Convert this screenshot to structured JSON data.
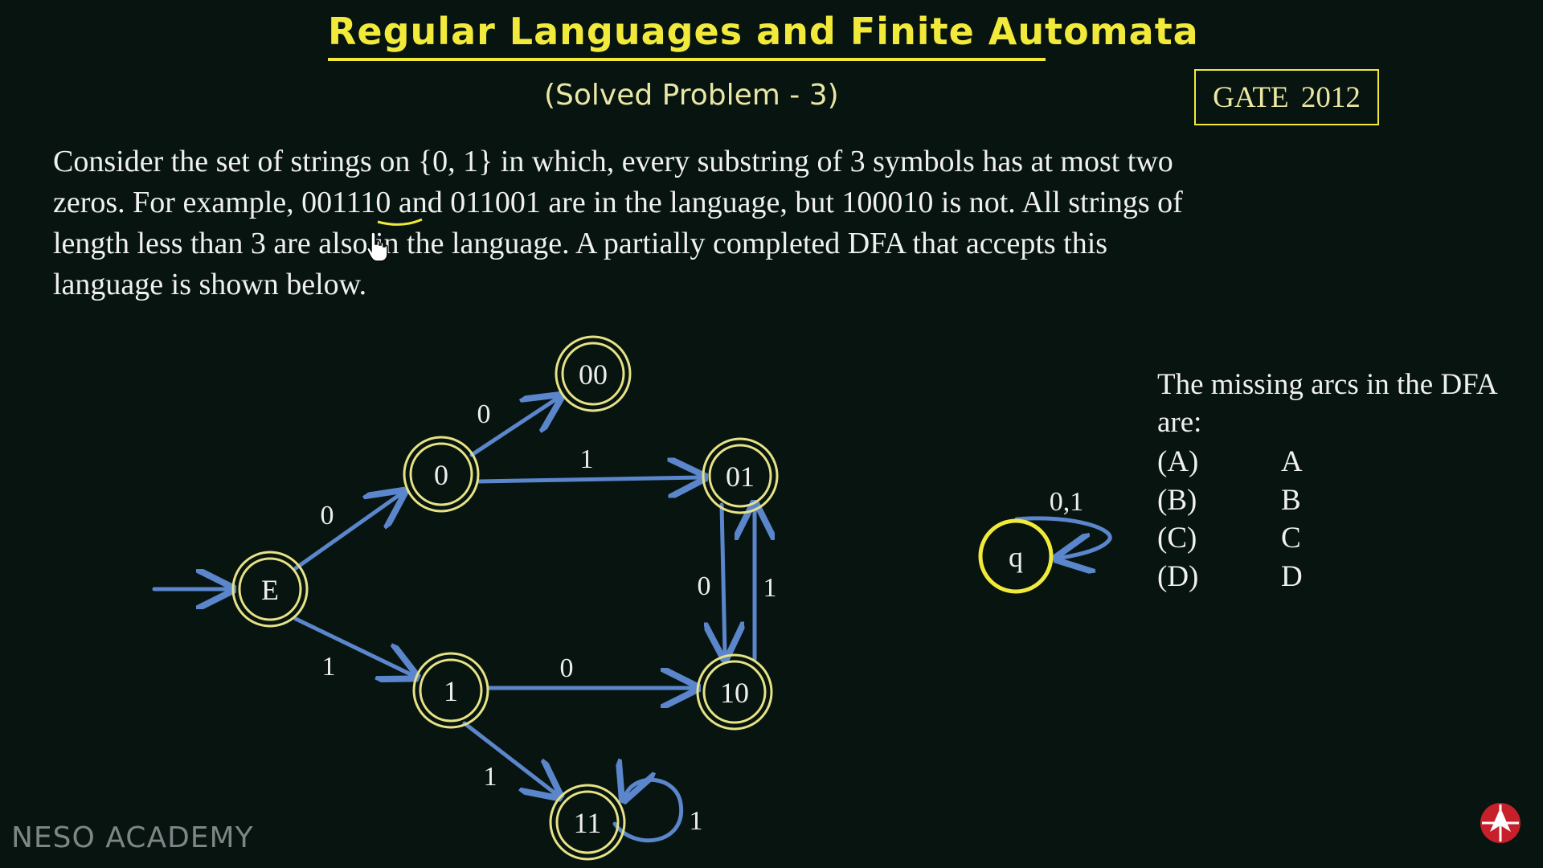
{
  "slide": {
    "title": "Regular Languages and Finite Automata",
    "subtitle": "(Solved Problem - 3)",
    "badge": "GATE  2012",
    "problem_lines": [
      "Consider the set of strings on {0, 1} in which, every substring of 3 symbols has at most two",
      "zeros. For example, 001110 and 011001 are in the language, but 100010 is not. All strings of",
      "length less than 3 are also in the language. A partially completed DFA that accepts this",
      "language is shown below."
    ],
    "question_lines": [
      "The missing arcs in the DFA",
      "are:"
    ],
    "options": [
      {
        "label": "(A)",
        "value": "A"
      },
      {
        "label": "(B)",
        "value": "B"
      },
      {
        "label": "(C)",
        "value": "C"
      },
      {
        "label": "(D)",
        "value": "D"
      }
    ],
    "watermark": "NESO ACADEMY"
  },
  "dfa": {
    "states": {
      "E": "E",
      "s0": "0",
      "s00": "00",
      "s01": "01",
      "s1": "1",
      "s10": "10",
      "s11": "11",
      "q": "q"
    },
    "arc_labels": {
      "E_to_0": "0",
      "0_to_00": "0",
      "0_to_01": "1",
      "E_to_1": "1",
      "1_to_10": "0",
      "1_to_11": "1",
      "01_to_10": "0",
      "10_to_01": "1",
      "11_loop": "1",
      "q_loop": "0,1"
    }
  },
  "colors": {
    "background": "#071410",
    "title": "#f2ea3a",
    "state_outline": "#e6e285",
    "arrow": "#5b86cc",
    "text": "#f0f0f0",
    "watermark": "#7e8685",
    "logo": "#c8202a"
  }
}
